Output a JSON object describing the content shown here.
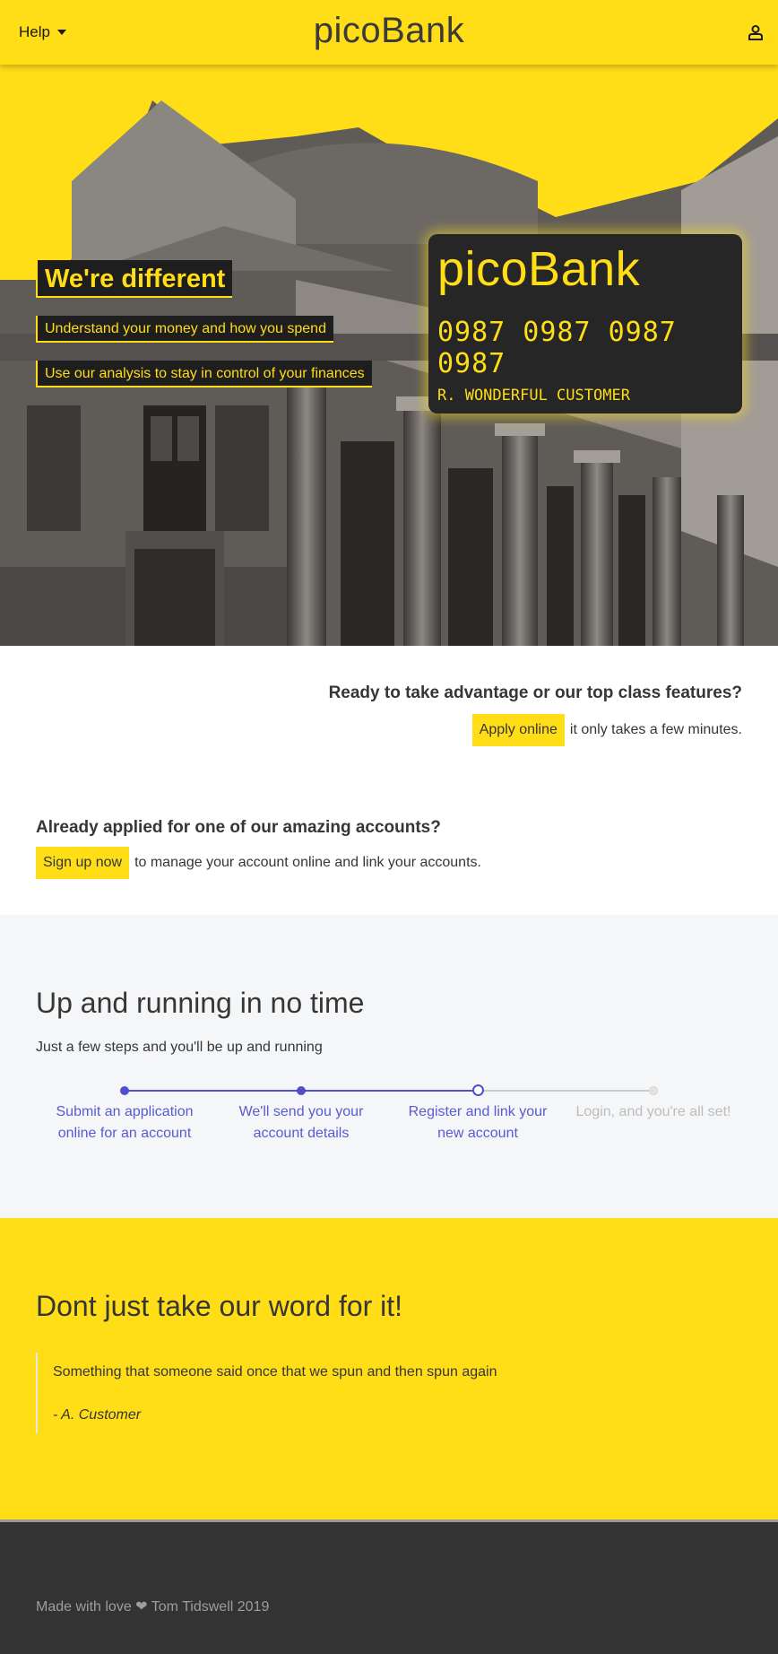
{
  "navbar": {
    "help_label": "Help",
    "brand": "picoBank",
    "user_icon": "user-icon",
    "background": "#ffdd17"
  },
  "hero": {
    "headline": "We're different",
    "tagline_1": "Understand your money and how you spend",
    "tagline_2": "Use our analysis to stay in control of your finances"
  },
  "card": {
    "brand": "picoBank",
    "number": "0987 0987 0987 0987",
    "holder": "R. WONDERFUL CUSTOMER"
  },
  "apply": {
    "question": "Ready to take advantage or our top class features?",
    "button_label": "Apply online",
    "suffix": "it only takes a few minutes."
  },
  "signup": {
    "question": "Already applied for one of our amazing accounts?",
    "button_label": "Sign up now",
    "suffix": "to manage your account online and link your accounts."
  },
  "steps": {
    "title": "Up and running in no time",
    "subtitle": "Just a few steps and you'll be up and running",
    "items": [
      {
        "label": "Submit an application online for an account",
        "state": "done"
      },
      {
        "label": "We'll send you your account details",
        "state": "done"
      },
      {
        "label": "Register and link your new account",
        "state": "current"
      },
      {
        "label": "Login, and you're all set!",
        "state": "pending"
      }
    ],
    "active_color": "#4f4fd0",
    "inactive_color": "#cccccc"
  },
  "testimonial": {
    "title": "Dont just take our word for it!",
    "quote": "Something that someone said once that we spun and then spun again",
    "author": "- A. Customer"
  },
  "footer": {
    "text": "Made with love ❤ Tom Tidswell 2019"
  }
}
